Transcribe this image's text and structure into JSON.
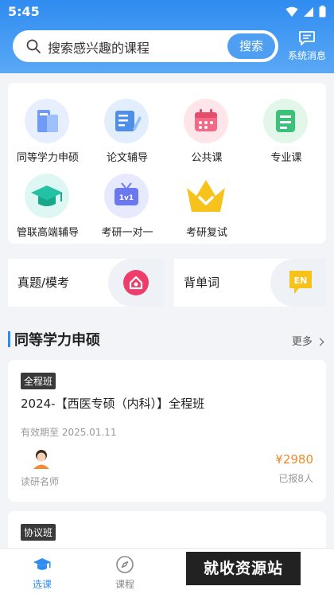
{
  "status_bar": {
    "time": "5:45"
  },
  "search": {
    "placeholder": "搜索感兴趣的课程",
    "button": "搜索"
  },
  "system_message": {
    "label": "系统消息"
  },
  "categories": [
    {
      "label": "同等学力申硕",
      "icon": "books-icon"
    },
    {
      "label": "论文辅导",
      "icon": "notebook-pen-icon"
    },
    {
      "label": "公共课",
      "icon": "calendar-icon"
    },
    {
      "label": "专业课",
      "icon": "document-icon"
    },
    {
      "label": "管联高端辅导",
      "icon": "graduation-cap-icon"
    },
    {
      "label": "考研一对一",
      "icon": "tv-1v1-icon"
    },
    {
      "label": "考研复试",
      "icon": "crown-icon"
    }
  ],
  "quick_links": [
    {
      "label": "真题/模考",
      "icon": "mock-exam-icon"
    },
    {
      "label": "背单词",
      "icon": "en-bubble-icon",
      "badge": "EN"
    }
  ],
  "section": {
    "title": "同等学力申硕",
    "more": "更多"
  },
  "courses": [
    {
      "tag": "全程班",
      "title": "2024-【西医专硕（内科）】全程班",
      "valid_until": "有效期至 2025.01.11",
      "teacher": "读研名师",
      "price": "¥2980",
      "enrolled": "已报8人"
    },
    {
      "tag": "协议班"
    }
  ],
  "tabs": [
    {
      "label": "选课",
      "icon": "graduation-cap-icon",
      "active": true
    },
    {
      "label": "课程",
      "icon": "compass-icon",
      "active": false
    }
  ],
  "watermark": "就收资源站",
  "colors": {
    "primary": "#2f8cf0",
    "price": "#f08a2b"
  }
}
